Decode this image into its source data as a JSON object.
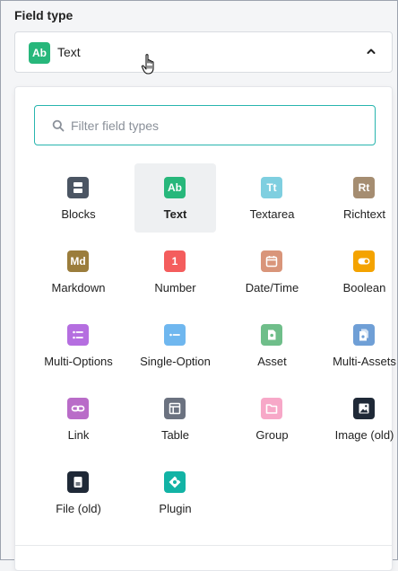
{
  "field_label": "Field type",
  "select": {
    "badge": "Ab",
    "value": "Text",
    "badge_color": "#27b77b"
  },
  "search": {
    "placeholder": "Filter field types",
    "value": ""
  },
  "field_types": [
    {
      "label": "Blocks",
      "icon": "blocks-icon",
      "color": "#4b5563",
      "glyph": ""
    },
    {
      "label": "Text",
      "icon": "text-icon",
      "color": "#27b77b",
      "glyph": "Ab",
      "selected": true
    },
    {
      "label": "Textarea",
      "icon": "textarea-icon",
      "color": "#7fcfe0",
      "glyph": "Tt"
    },
    {
      "label": "Richtext",
      "icon": "richtext-icon",
      "color": "#a58d71",
      "glyph": "Rt"
    },
    {
      "label": "Markdown",
      "icon": "markdown-icon",
      "color": "#9b7d3c",
      "glyph": "Md"
    },
    {
      "label": "Number",
      "icon": "number-icon",
      "color": "#f45d5d",
      "glyph": "1"
    },
    {
      "label": "Date/Time",
      "icon": "calendar-icon",
      "color": "#d9957a",
      "glyph": ""
    },
    {
      "label": "Boolean",
      "icon": "toggle-icon",
      "color": "#f4a300",
      "glyph": ""
    },
    {
      "label": "Multi-Options",
      "icon": "list-icon",
      "color": "#b56ee0",
      "glyph": ""
    },
    {
      "label": "Single-Option",
      "icon": "single-option-icon",
      "color": "#6fb7ef",
      "glyph": ""
    },
    {
      "label": "Asset",
      "icon": "asset-icon",
      "color": "#6fbe8a",
      "glyph": ""
    },
    {
      "label": "Multi-Assets",
      "icon": "multi-assets-icon",
      "color": "#6f9fd6",
      "glyph": ""
    },
    {
      "label": "Link",
      "icon": "link-icon",
      "color": "#b96cc8",
      "glyph": ""
    },
    {
      "label": "Table",
      "icon": "table-icon",
      "color": "#6b7280",
      "glyph": ""
    },
    {
      "label": "Group",
      "icon": "folder-icon",
      "color": "#f7a8c8",
      "glyph": ""
    },
    {
      "label": "Image (old)",
      "icon": "image-icon",
      "color": "#1f2937",
      "glyph": ""
    },
    {
      "label": "File (old)",
      "icon": "file-icon",
      "color": "#1f2937",
      "glyph": ""
    },
    {
      "label": "Plugin",
      "icon": "plugin-icon",
      "color": "#12b3a5",
      "glyph": ""
    }
  ]
}
